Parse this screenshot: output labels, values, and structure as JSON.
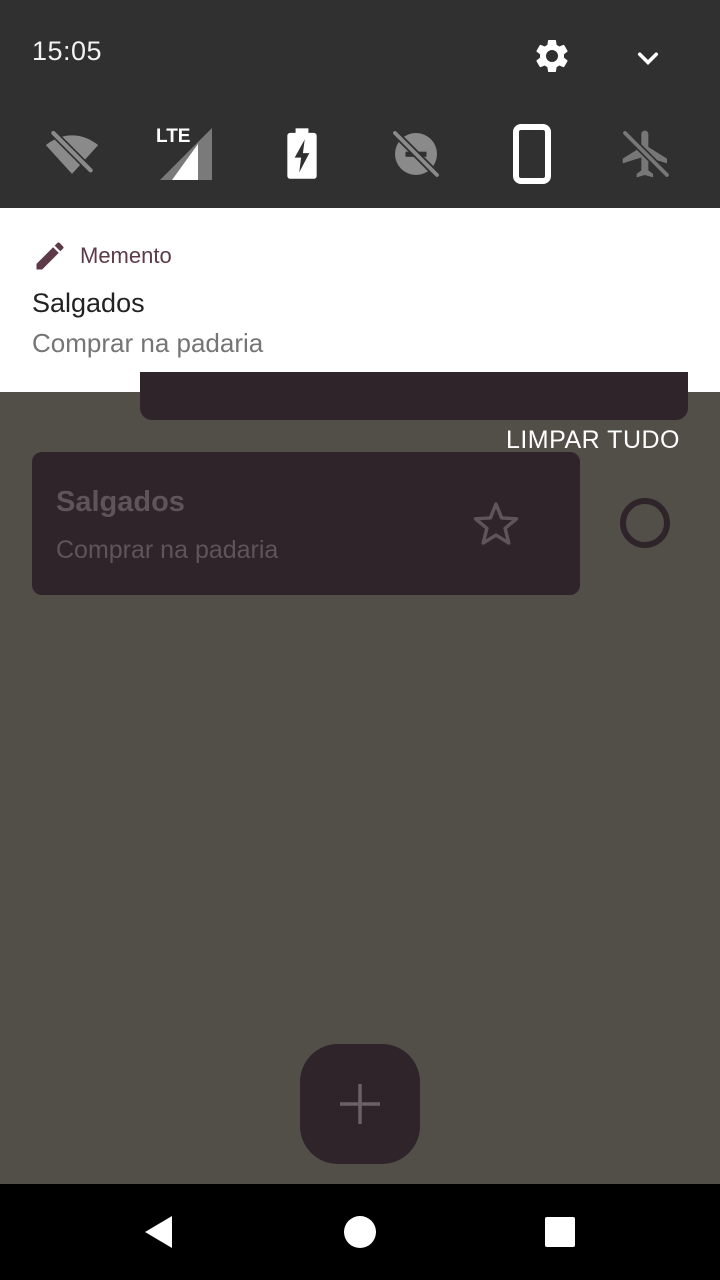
{
  "status": {
    "time": "15:05"
  },
  "quick_settings": {
    "icons": [
      "wifi-off-icon",
      "lte-signal-icon",
      "battery-charging-icon",
      "data-saver-icon",
      "screen-rotation-icon",
      "airplane-mode-icon"
    ],
    "lte_label": "LTE"
  },
  "notification": {
    "app_name": "Memento",
    "title": "Salgados",
    "text": "Comprar na padaria",
    "accent_color": "#5c3a48"
  },
  "app": {
    "clear_all_label": "LIMPAR TUDO",
    "note": {
      "title": "Salgados",
      "text": "Comprar na padaria"
    },
    "fab_icon": "plus-icon"
  },
  "colors": {
    "background": "#524f49",
    "card": "#2e2429",
    "header": "#303030"
  }
}
